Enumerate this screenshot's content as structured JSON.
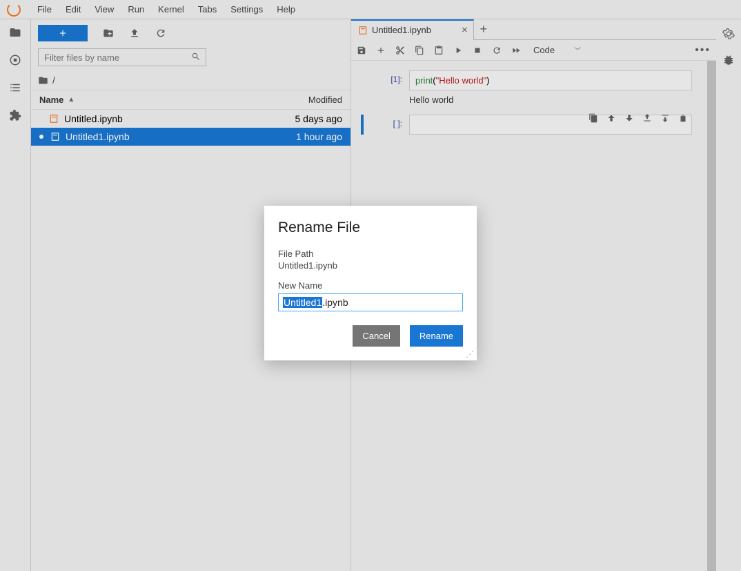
{
  "menu": {
    "items": [
      "File",
      "Edit",
      "View",
      "Run",
      "Kernel",
      "Tabs",
      "Settings",
      "Help"
    ]
  },
  "filebrowser": {
    "filter_placeholder": "Filter files by name",
    "breadcrumb": "/",
    "header_name": "Name",
    "header_modified": "Modified",
    "rows": [
      {
        "name": "Untitled.ipynb",
        "modified": "5 days ago",
        "selected": false,
        "running": false
      },
      {
        "name": "Untitled1.ipynb",
        "modified": "1 hour ago",
        "selected": true,
        "running": true
      }
    ]
  },
  "tab": {
    "title": "Untitled1.ipynb"
  },
  "nbtoolbar": {
    "celltype": "Code"
  },
  "notebook": {
    "cell1_prompt": "[1]:",
    "cell1_fn": "print",
    "cell1_str": "\"Hello world\"",
    "cell1_output": "Hello world",
    "cell2_prompt": "[ ]:"
  },
  "dialog": {
    "title": "Rename File",
    "path_label": "File Path",
    "path": "Untitled1.ipynb",
    "newname_label": "New Name",
    "input_selected": "Untitled1",
    "input_ext": ".ipynb",
    "cancel": "Cancel",
    "rename": "Rename"
  }
}
